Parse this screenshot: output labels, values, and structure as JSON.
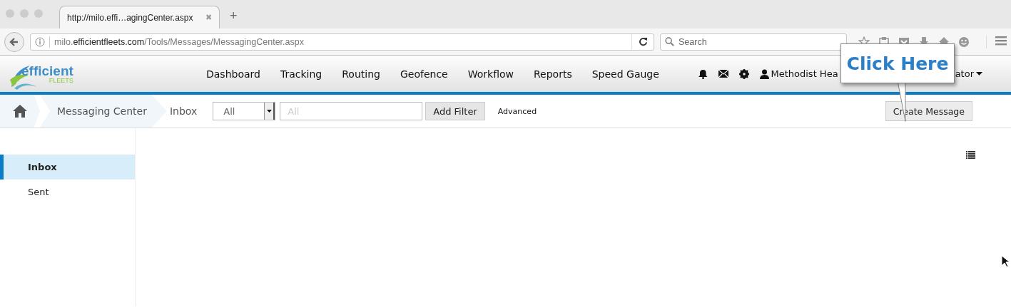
{
  "browser": {
    "tab": {
      "title": "http://milo.effi…agingCenter.aspx",
      "close": "✖",
      "selected": true
    },
    "new_tab": "+",
    "address": {
      "host_prefix": "milo.",
      "host": "efficientfleets.com",
      "path": "/Tools/Messages/MessagingCenter.aspx"
    },
    "search": {
      "placeholder": "Search"
    }
  },
  "app": {
    "logo": {
      "word": "efficient",
      "sub": "FLEETS"
    },
    "nav": [
      {
        "label": "Dashboard"
      },
      {
        "label": "Tracking"
      },
      {
        "label": "Routing"
      },
      {
        "label": "Geofence"
      },
      {
        "label": "Workflow"
      },
      {
        "label": "Reports"
      },
      {
        "label": "Speed Gauge"
      }
    ],
    "user": {
      "name_start": "Methodist Hea",
      "name_end": "ator"
    }
  },
  "callout": {
    "text": "Click Here"
  },
  "breadcrumb": [
    {
      "label": "Messaging Center"
    },
    {
      "label": "Inbox"
    }
  ],
  "filter": {
    "select": "All",
    "placeholder": "All",
    "add_button": "Add Filter",
    "advanced": "Advanced"
  },
  "create_button": "Create Message",
  "sidebar": [
    {
      "label": "Inbox",
      "selected": true
    },
    {
      "label": "Sent",
      "selected": false
    }
  ]
}
